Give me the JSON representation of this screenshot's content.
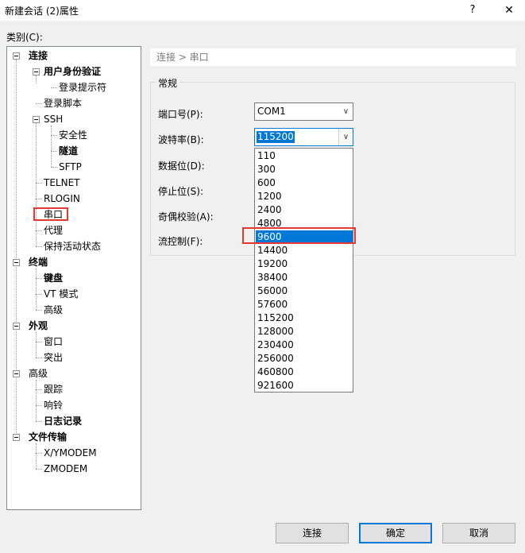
{
  "window": {
    "title": "新建会话 (2)属性",
    "help_glyph": "?",
    "close_glyph": "✕"
  },
  "category_label": "类别(C):",
  "tree": {
    "connection": "连接",
    "auth": "用户身份验证",
    "login_prompt": "登录提示符",
    "login_script": "登录脚本",
    "ssh": "SSH",
    "security": "安全性",
    "tunnel": "隧道",
    "sftp": "SFTP",
    "telnet": "TELNET",
    "rlogin": "RLOGIN",
    "serial": "串口",
    "proxy": "代理",
    "keepalive": "保持活动状态",
    "terminal": "终端",
    "keyboard": "键盘",
    "vt_mode": "VT 模式",
    "advanced": "高级",
    "appearance": "外观",
    "window": "窗口",
    "highlight": "突出",
    "advanced2": "高级",
    "trace": "跟踪",
    "bell": "响铃",
    "logging": "日志记录",
    "file_transfer": "文件传输",
    "xymodem": "X/YMODEM",
    "zmodem": "ZMODEM"
  },
  "breadcrumb": "连接 > 串口",
  "group_title": "常规",
  "fields": {
    "port_label": "端口号(P):",
    "port_value": "COM1",
    "baud_label": "波特率(B):",
    "baud_value": "115200",
    "data_bits_label": "数据位(D):",
    "stop_bits_label": "停止位(S):",
    "parity_label": "奇偶校验(A):",
    "flow_label": "流控制(F):"
  },
  "baud_options": [
    "110",
    "300",
    "600",
    "1200",
    "2400",
    "4800",
    "9600",
    "14400",
    "19200",
    "38400",
    "56000",
    "57600",
    "115200",
    "128000",
    "230400",
    "256000",
    "460800",
    "921600"
  ],
  "buttons": {
    "connect": "连接",
    "ok": "确定",
    "cancel": "取消"
  }
}
